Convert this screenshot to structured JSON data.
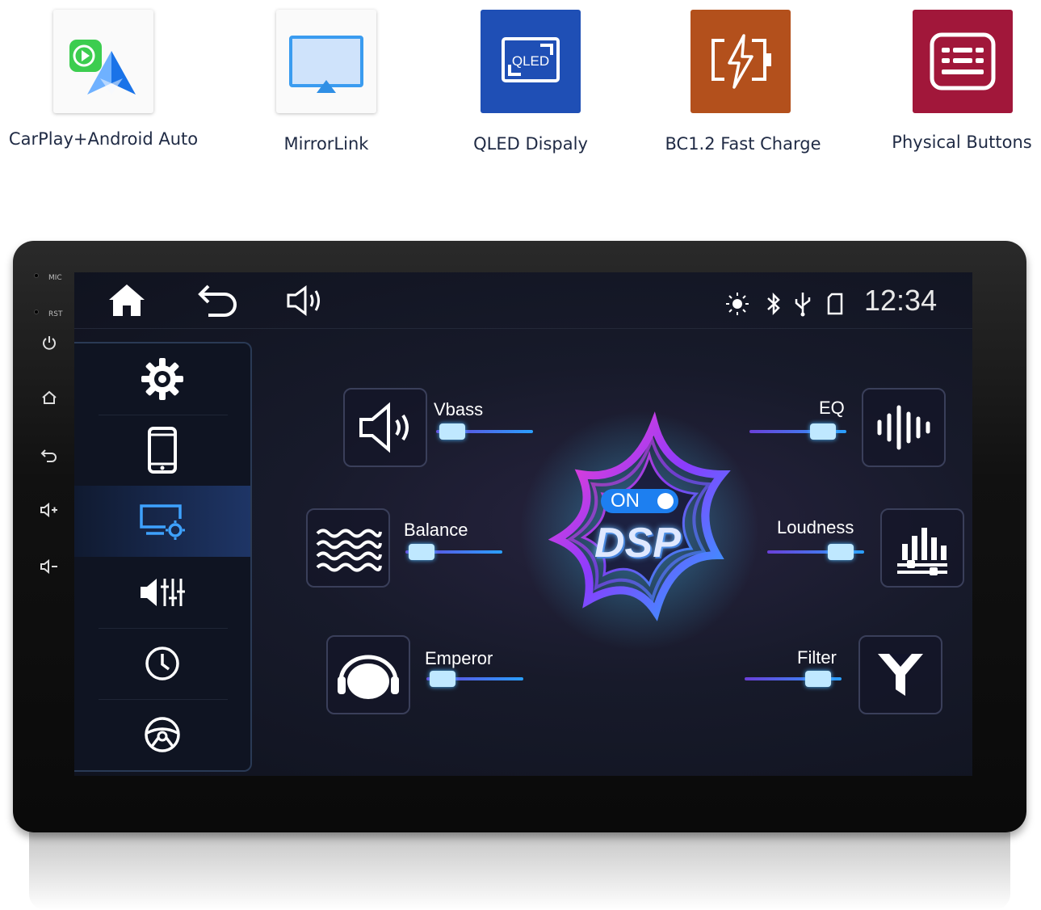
{
  "features": [
    {
      "label": "CarPlay+Android Auto",
      "icon": "carplay-android-auto-icon"
    },
    {
      "label": "MirrorLink",
      "icon": "mirrorlink-icon"
    },
    {
      "label": "QLED Dispaly",
      "icon": "qled-display-icon",
      "icon_text": "QLED"
    },
    {
      "label": "BC1.2 Fast Charge",
      "icon": "fast-charge-icon"
    },
    {
      "label": "Physical Buttons",
      "icon": "keyboard-icon"
    }
  ],
  "device": {
    "mic_label": "MIC",
    "rst_label": "RST"
  },
  "statusbar": {
    "time": "12:34"
  },
  "dsp": {
    "toggle_label": "ON",
    "title": "DSP",
    "options": [
      {
        "label": "Vbass",
        "level": 0.05
      },
      {
        "label": "EQ",
        "level": 0.85
      },
      {
        "label": "Balance",
        "level": 0.05
      },
      {
        "label": "Loudness",
        "level": 0.85
      },
      {
        "label": "Emperor",
        "level": 0.05
      },
      {
        "label": "Filter",
        "level": 0.85
      }
    ]
  },
  "colors": {
    "carplay_green": "#3ccd4f",
    "android_blue": "#3a8ef6",
    "qled_blue": "#1f4fb5",
    "charge_orange": "#b3501c",
    "buttons_red": "#a1173a",
    "slider_gradient_start": "#6a3fd8",
    "slider_gradient_end": "#2aa0ff",
    "active_tab": "#1e3566"
  }
}
